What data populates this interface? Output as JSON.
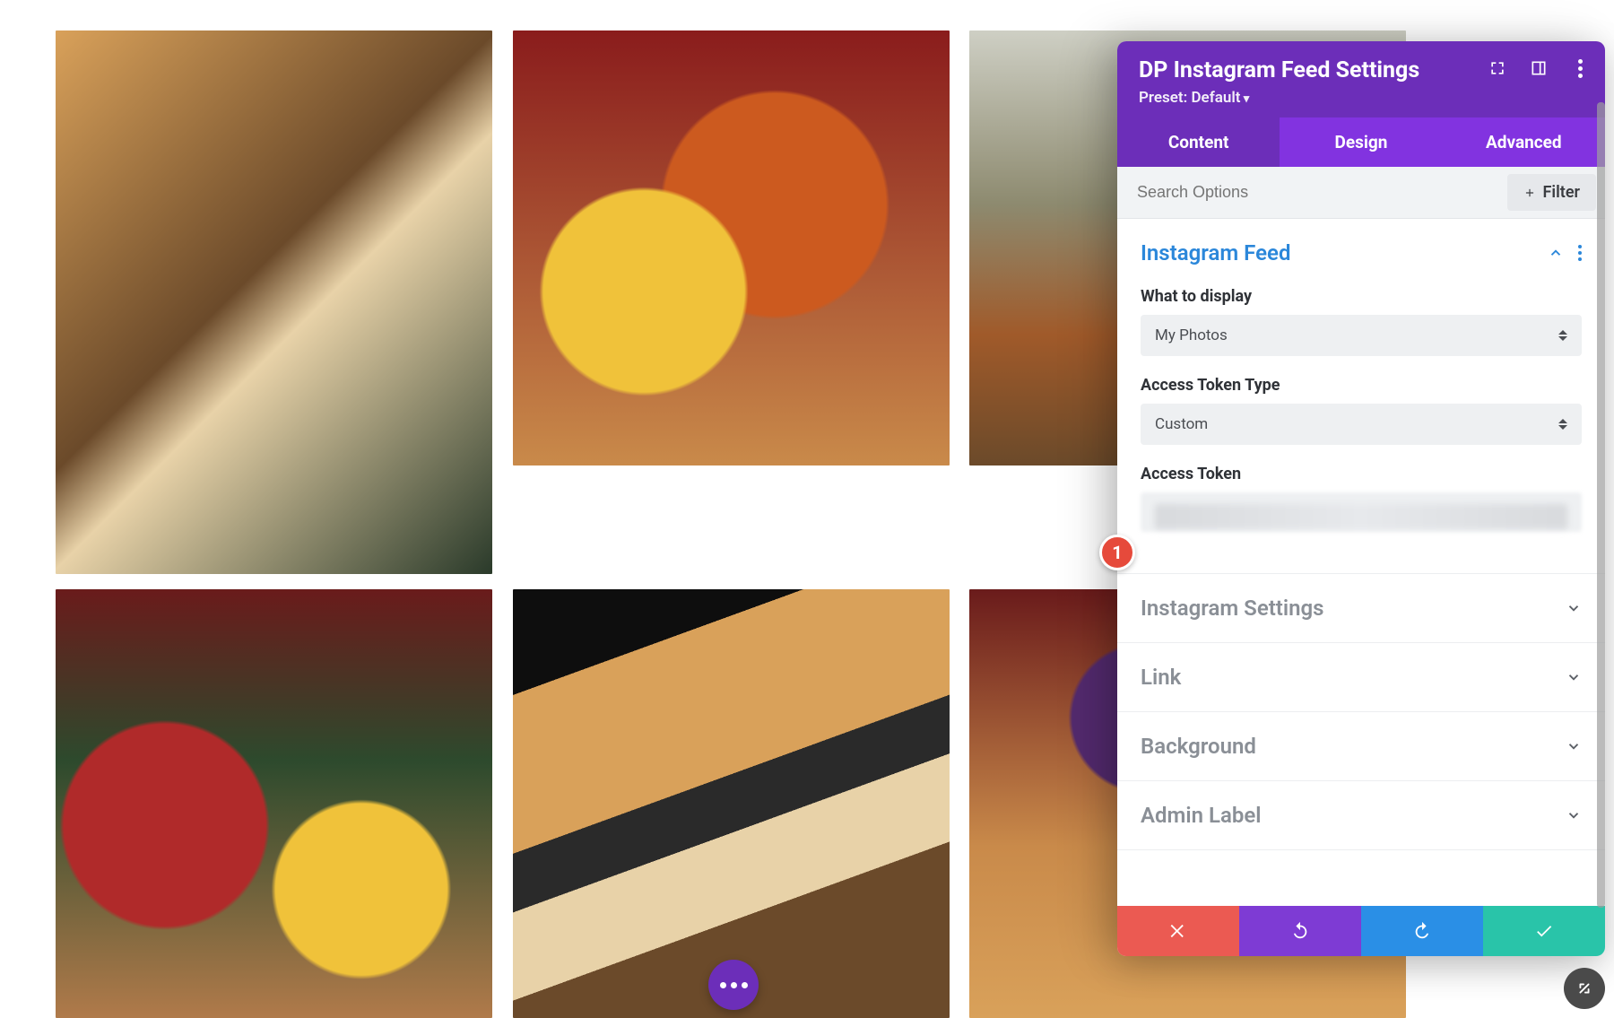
{
  "panel": {
    "title": "DP Instagram Feed Settings",
    "preset_label": "Preset: Default",
    "tabs": {
      "content": "Content",
      "design": "Design",
      "advanced": "Advanced",
      "active": "content"
    },
    "search": {
      "placeholder": "Search Options",
      "filter_label": "Filter"
    },
    "sections": {
      "feed": {
        "title": "Instagram Feed",
        "open": true,
        "fields": {
          "what_to_display": {
            "label": "What to display",
            "value": "My Photos"
          },
          "token_type": {
            "label": "Access Token Type",
            "value": "Custom"
          },
          "access_token": {
            "label": "Access Token",
            "value": ""
          }
        }
      },
      "settings": {
        "title": "Instagram Settings",
        "open": false
      },
      "link": {
        "title": "Link",
        "open": false
      },
      "background": {
        "title": "Background",
        "open": false
      },
      "admin": {
        "title": "Admin Label",
        "open": false
      }
    }
  },
  "annotation": {
    "badge_1": "1"
  },
  "colors": {
    "purple_dark": "#6c2eb9",
    "purple_light": "#8233e0",
    "blue": "#2b87da",
    "red": "#eb5a52",
    "teal": "#29c4a9",
    "action_blue": "#2a8fe6"
  }
}
